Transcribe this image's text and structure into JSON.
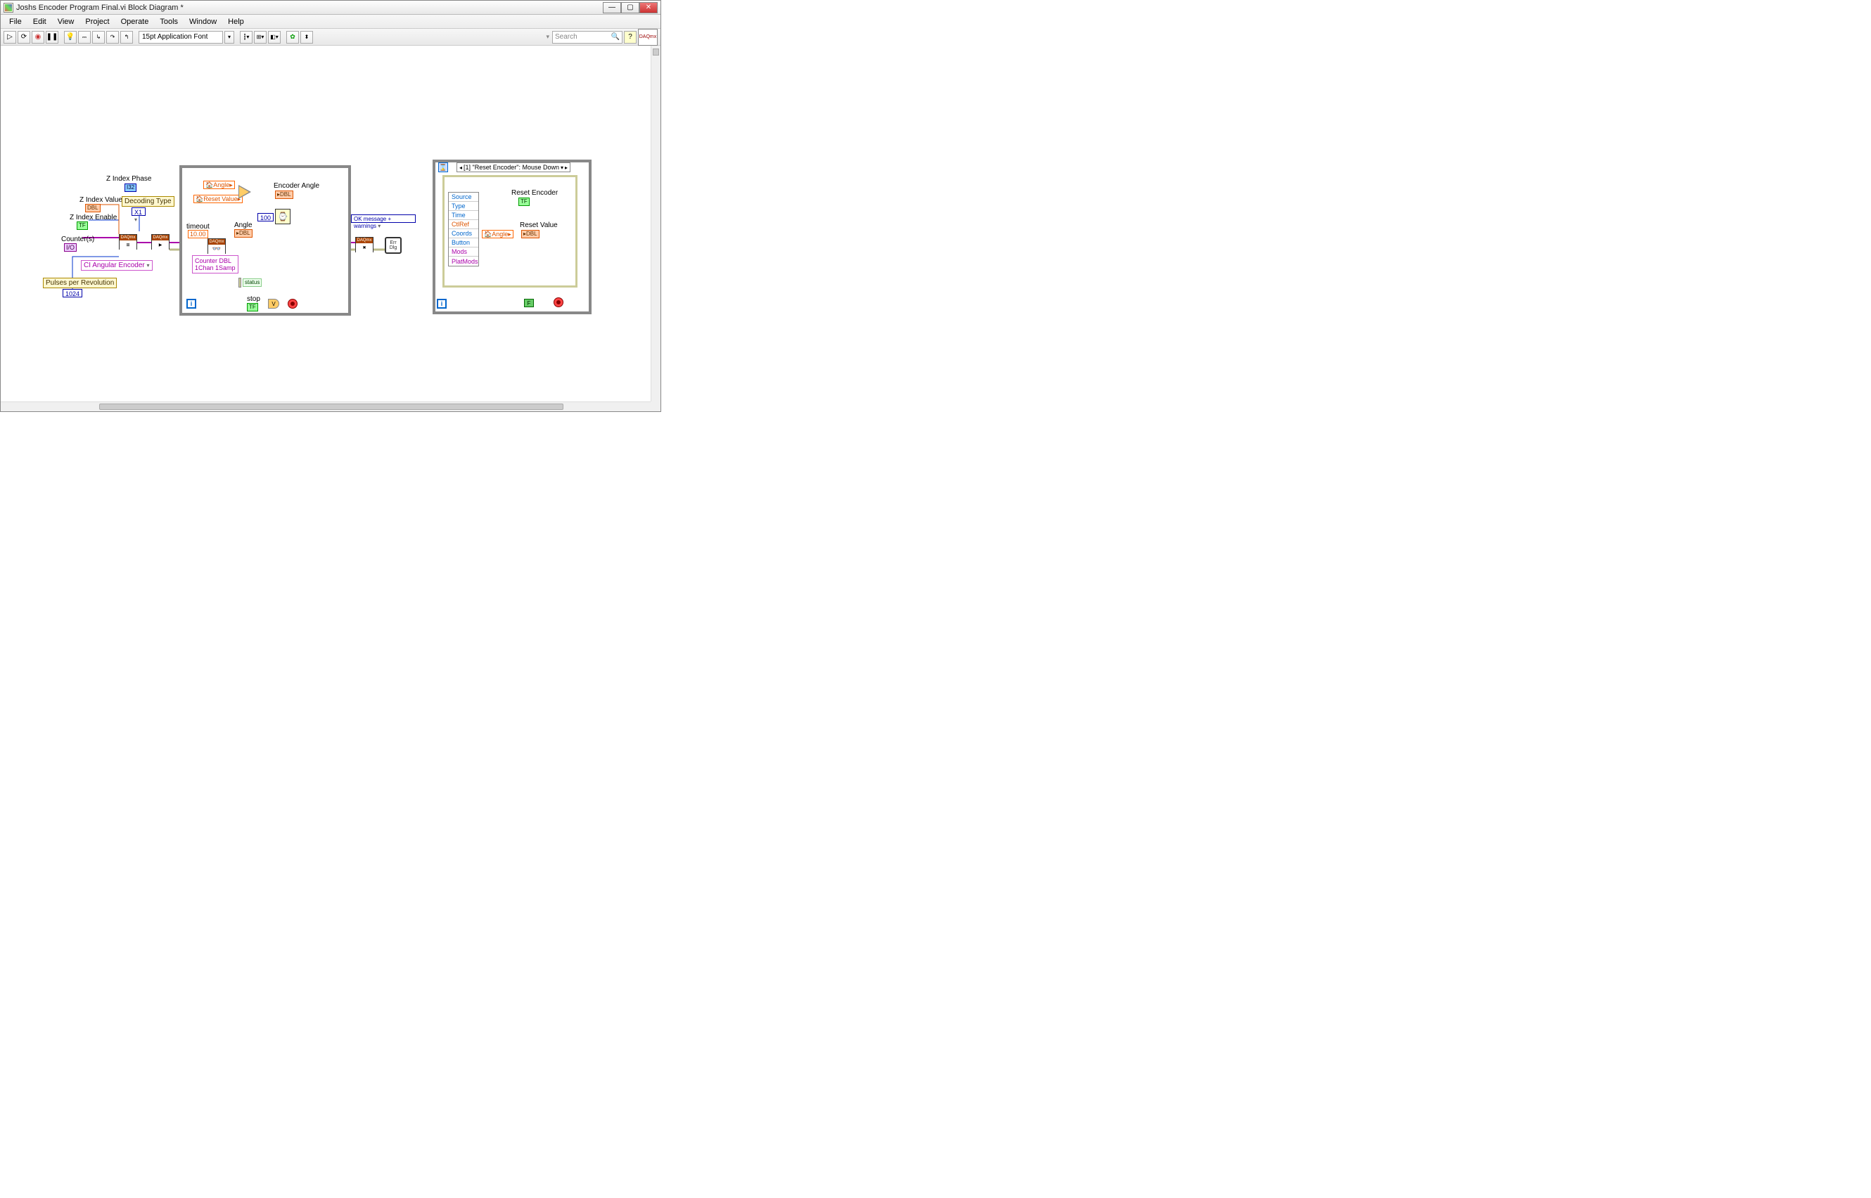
{
  "window": {
    "title": "Joshs Encoder Program Final.vi Block Diagram *"
  },
  "menu": {
    "file": "File",
    "edit": "Edit",
    "view": "View",
    "project": "Project",
    "operate": "Operate",
    "tools": "Tools",
    "window": "Window",
    "help": "Help"
  },
  "toolbar": {
    "font": "15pt Application Font",
    "search_placeholder": "Search",
    "context_help": "?"
  },
  "left": {
    "z_phase_lbl": "Z Index Phase",
    "z_phase_val": "I32",
    "z_value_lbl": "Z Index Value",
    "z_value_val": "DBL",
    "z_enable_lbl": "Z Index Enable",
    "z_enable_val": "TF",
    "decoding_lbl": "Decoding Type",
    "decoding_val": "X1",
    "counters_lbl": "Counter(s)",
    "counters_val": "I/O",
    "ci_enc": "CI Angular Encoder",
    "ppr_lbl": "Pulses per Revolution",
    "ppr_val": "1024"
  },
  "loop": {
    "timeout_lbl": "timeout",
    "timeout_val": "10.00",
    "angle_lbl": "Angle",
    "angle_val": "DBL",
    "angle_local": "Angle",
    "reset_local": "Reset Value",
    "enc_angle_lbl": "Encoder Angle",
    "enc_angle_ind": "DBL",
    "wait_const": "100",
    "counter_sel": "Counter DBL\n1Chan 1Samp",
    "dialog": "OK message + warnings",
    "status": "status",
    "stop": "stop",
    "stop_val": "TF"
  },
  "event": {
    "case": "[1] \"Reset Encoder\": Mouse Down",
    "reset_enc_lbl": "Reset Encoder",
    "reset_enc_val": "TF",
    "reset_val_lbl": "Reset Value",
    "angle_local": "Angle",
    "dbl_ind": "DBL",
    "rows": [
      "Source",
      "Type",
      "Time",
      "CtlRef",
      "Coords",
      "Button",
      "Mods",
      "PlatMods"
    ],
    "row_colors": [
      "#06c",
      "#06c",
      "#06c",
      "#d50",
      "#06c",
      "#06c",
      "#a0a",
      "#a0a"
    ]
  }
}
